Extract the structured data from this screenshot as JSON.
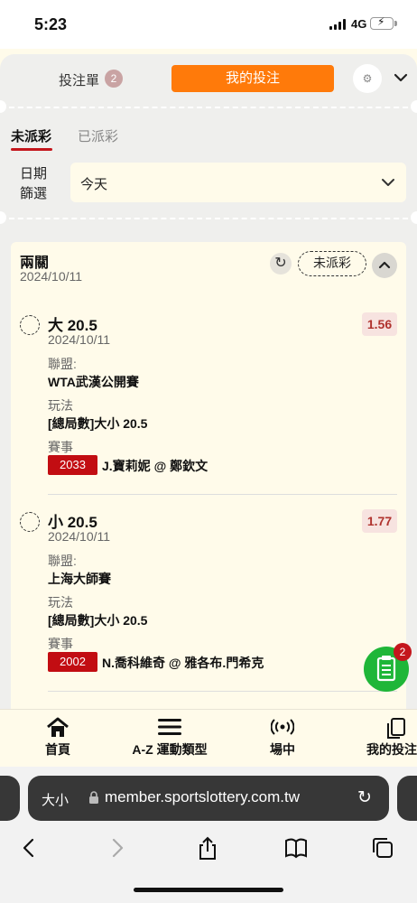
{
  "status_bar": {
    "time": "5:23",
    "network": "4G"
  },
  "header": {
    "betslip_label": "投注單",
    "betslip_count": "2",
    "my_bets_label": "我的投注",
    "accent_color": "#ff7a0a"
  },
  "subtabs": {
    "unsettled": "未派彩",
    "settled": "已派彩"
  },
  "date_filter": {
    "label": "日期篩選",
    "value": "今天"
  },
  "bet_card": {
    "title": "兩關",
    "date": "2024/10/11",
    "status": "未派彩",
    "legs": [
      {
        "pick": "大 20.5",
        "date": "2024/10/11",
        "odds": "1.56",
        "league_label": "聯盟:",
        "league": "WTA武漢公開賽",
        "market_label": "玩法",
        "market": "[總局數]大小 20.5",
        "event_label": "賽事",
        "game_id": "2033",
        "match": "J.寶莉妮 @ 鄭欽文"
      },
      {
        "pick": "小 20.5",
        "date": "2024/10/11",
        "odds": "1.77",
        "league_label": "聯盟:",
        "league": "上海大師賽",
        "market_label": "玩法",
        "market": "[總局數]大小 20.5",
        "event_label": "賽事",
        "game_id": "2002",
        "match": "N.喬科維奇 @ 雅各布.門希克"
      }
    ]
  },
  "fab": {
    "badge": "2"
  },
  "bottom_nav": [
    {
      "label": "首頁",
      "icon": "home-icon"
    },
    {
      "label": "A-Z 運動類型",
      "icon": "menu-icon"
    },
    {
      "label": "場中",
      "icon": "live-icon"
    },
    {
      "label": "我的投注",
      "icon": "copy-icon"
    }
  ],
  "browser": {
    "text_size": "大小",
    "url": "member.sportslottery.com.tw"
  }
}
